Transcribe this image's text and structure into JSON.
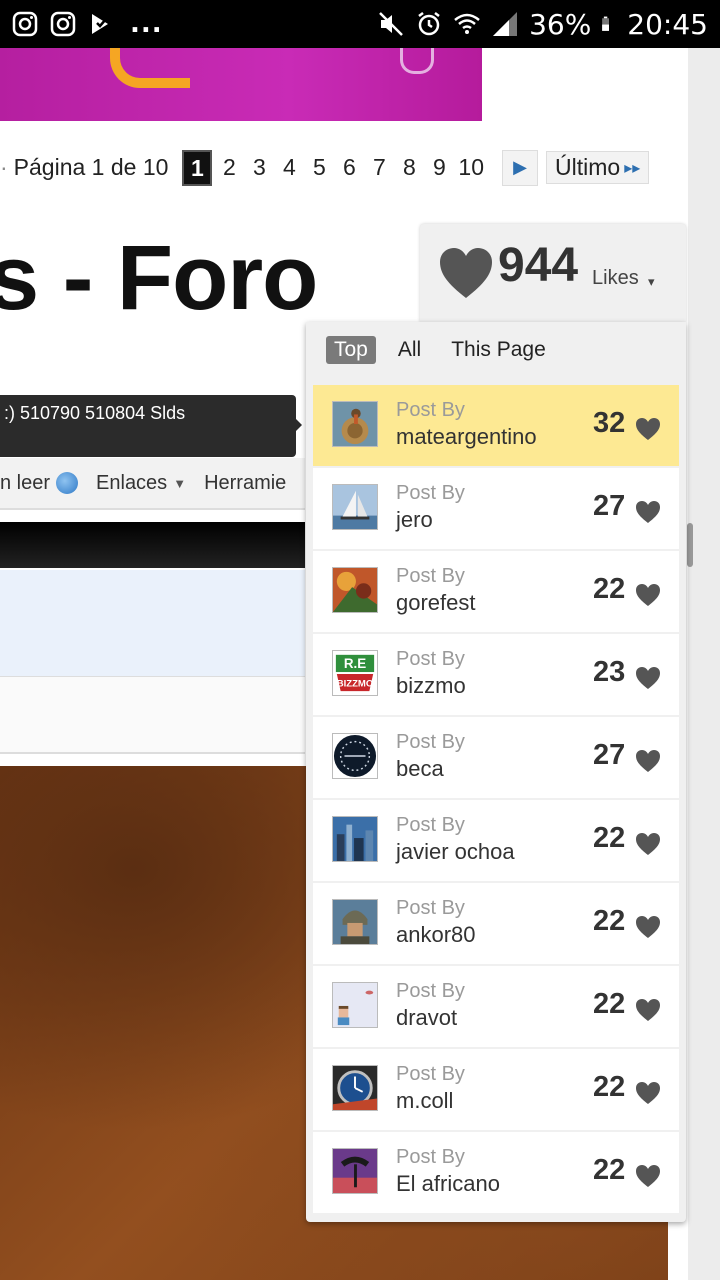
{
  "status_bar": {
    "left_icons": [
      "instagram-icon",
      "instagram-icon",
      "delivery-app-icon"
    ],
    "overflow": "...",
    "battery": "36%",
    "time": "20:45"
  },
  "pager": {
    "prefix": "·",
    "label": "Página 1 de 10",
    "pages": [
      "1",
      "2",
      "3",
      "4",
      "5",
      "6",
      "7",
      "8",
      "9",
      "10"
    ],
    "current_page": "1",
    "next_arrow": "▶",
    "last_label": "Último",
    "last_arrow": "▸▸"
  },
  "forum_title": "s - Foro",
  "notice_text": ":) 510790 510804 Slds",
  "nav": {
    "items": [
      "n leer",
      "Enlaces",
      "Herramie"
    ]
  },
  "likes": {
    "count": "944",
    "label": "Likes",
    "caret": "▾"
  },
  "tabs": {
    "top": "Top",
    "all": "All",
    "this_page": "This Page"
  },
  "post_by_label": "Post By",
  "top_posts": [
    {
      "user": "mateargentino",
      "likes": "32",
      "avatar": "owl-on-cork"
    },
    {
      "user": "jero",
      "likes": "27",
      "avatar": "sailboat"
    },
    {
      "user": "gorefest",
      "likes": "22",
      "avatar": "painting"
    },
    {
      "user": "bizzmo",
      "likes": "23",
      "avatar": "bizzmo-logo"
    },
    {
      "user": "beca",
      "likes": "27",
      "avatar": "round-badge"
    },
    {
      "user": "javier ochoa",
      "likes": "22",
      "avatar": "city-skyline"
    },
    {
      "user": "ankor80",
      "likes": "22",
      "avatar": "helmet-warrior"
    },
    {
      "user": "dravot",
      "likes": "22",
      "avatar": "pixel-character"
    },
    {
      "user": "m.coll",
      "likes": "22",
      "avatar": "watch"
    },
    {
      "user": "El africano",
      "likes": "22",
      "avatar": "tree-sunset"
    }
  ],
  "colors": {
    "highlight_row": "#fde993",
    "heart": "#555555",
    "accent_blue": "#2d6fb0"
  }
}
